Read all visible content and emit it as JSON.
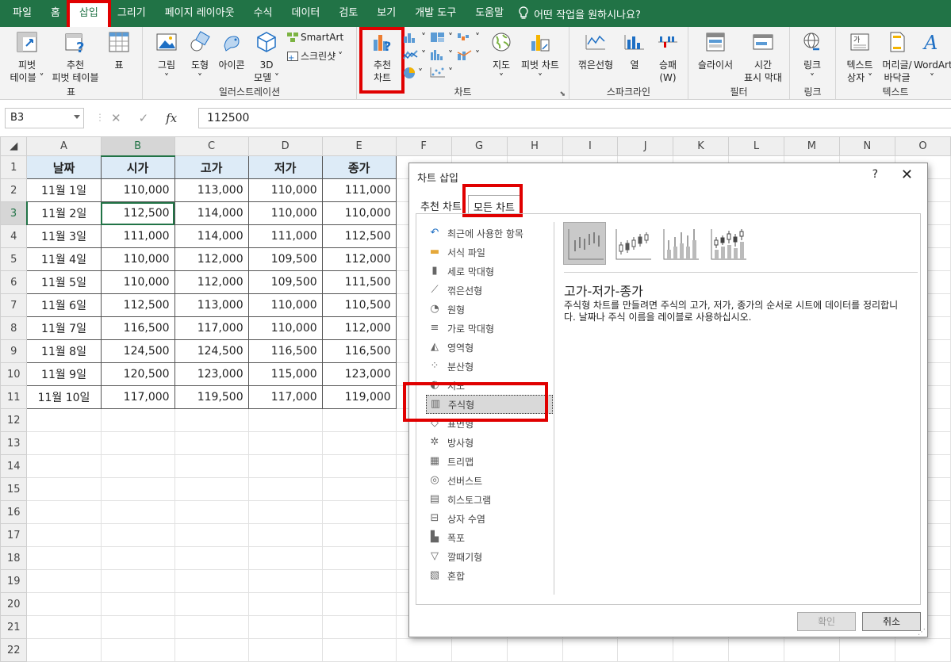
{
  "menu": {
    "tabs": [
      "파일",
      "홈",
      "삽입",
      "그리기",
      "페이지 레이아웃",
      "수식",
      "데이터",
      "검토",
      "보기",
      "개발 도구",
      "도움말"
    ],
    "active_tab": "삽입",
    "tell_me": "어떤 작업을 원하시나요?"
  },
  "ribbon": {
    "groups": {
      "table": "표",
      "illustrations": "일러스트레이션",
      "charts": "차트",
      "sparklines": "스파크라인",
      "filters": "필터",
      "links": "링크",
      "text": "텍스트"
    },
    "buttons": {
      "pivot_table_1": "피벗",
      "pivot_table_2": "테이블",
      "rec_pivot_1": "추천",
      "rec_pivot_2": "피벗 테이블",
      "table": "표",
      "picture": "그림",
      "shapes": "도형",
      "icons": "아이콘",
      "model3d_1": "3D",
      "model3d_2": "모델",
      "smartart": "SmartArt",
      "screenshot": "스크린샷",
      "rec_chart_1": "추천",
      "rec_chart_2": "차트",
      "maps": "지도",
      "pivot_chart": "피벗 차트",
      "spark_line": "꺾은선형",
      "spark_column": "열",
      "spark_winloss_1": "승패",
      "spark_winloss_2": "(W)",
      "slicer": "슬라이서",
      "timeline_1": "시간",
      "timeline_2": "표시 막대",
      "link": "링크",
      "textbox_1": "텍스트",
      "textbox_2": "상자",
      "header_footer_1": "머리글/",
      "header_footer_2": "바닥글",
      "wordart": "WordArt"
    }
  },
  "formula_bar": {
    "name_box": "B3",
    "fx": "fx",
    "value": "112500"
  },
  "sheet": {
    "columns": [
      "A",
      "B",
      "C",
      "D",
      "E",
      "F",
      "G",
      "H",
      "I",
      "J",
      "K",
      "L",
      "M",
      "N",
      "O"
    ],
    "selected_column": "B",
    "selected_row": 3,
    "headers": [
      "날짜",
      "시가",
      "고가",
      "저가",
      "종가"
    ],
    "rows": [
      [
        "11월 1일",
        "110,000",
        "113,000",
        "110,000",
        "111,000"
      ],
      [
        "11월 2일",
        "112,500",
        "114,000",
        "110,000",
        "110,000"
      ],
      [
        "11월 3일",
        "111,000",
        "114,000",
        "111,000",
        "112,500"
      ],
      [
        "11월 4일",
        "110,000",
        "112,000",
        "109,500",
        "112,000"
      ],
      [
        "11월 5일",
        "110,000",
        "112,000",
        "109,500",
        "111,500"
      ],
      [
        "11월 6일",
        "112,500",
        "113,000",
        "110,000",
        "110,500"
      ],
      [
        "11월 7일",
        "116,500",
        "117,000",
        "110,000",
        "112,000"
      ],
      [
        "11월 8일",
        "124,500",
        "124,500",
        "116,500",
        "116,500"
      ],
      [
        "11월 9일",
        "120,500",
        "123,000",
        "115,000",
        "123,000"
      ],
      [
        "11월 10일",
        "117,000",
        "119,500",
        "117,000",
        "119,000"
      ]
    ],
    "row_numbers": [
      1,
      2,
      3,
      4,
      5,
      6,
      7,
      8,
      9,
      10,
      11,
      12,
      13,
      14,
      15,
      16,
      17,
      18,
      19,
      20,
      21,
      22
    ]
  },
  "dialog": {
    "title": "차트 삽입",
    "help": "?",
    "close": "✕",
    "tabs": [
      "추천 차트",
      "모든 차트"
    ],
    "active_tab": "모든 차트",
    "categories": [
      "최근에 사용한 항목",
      "서식 파일",
      "세로 막대형",
      "꺾은선형",
      "원형",
      "가로 막대형",
      "영역형",
      "분산형",
      "지도",
      "주식형",
      "표면형",
      "방사형",
      "트리맵",
      "선버스트",
      "히스토그램",
      "상자 수염",
      "폭포",
      "깔때기형",
      "혼합"
    ],
    "selected_category": "주식형",
    "subtype_title": "고가-저가-종가",
    "subtype_desc": "주식형 차트를 만들려면 주식의 고가, 저가, 종가의 순서로 시트에 데이터를 정리합니다. 날짜나 주식 이름을 레이블로 사용하십시오.",
    "ok": "확인",
    "cancel": "취소"
  },
  "colors": {
    "excel_green": "#217346",
    "highlight_red": "#e00000",
    "header_fill": "#ddebf7"
  }
}
